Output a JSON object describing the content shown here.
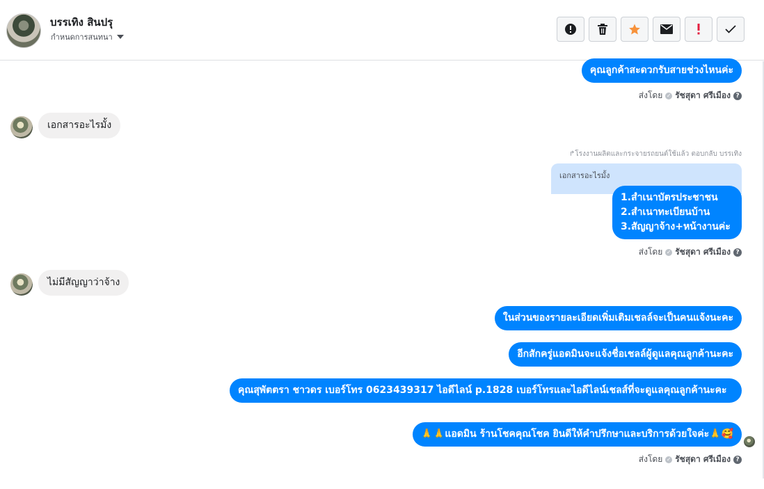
{
  "header": {
    "user_name": "บรรเทิง สินปรุ",
    "assign_label": "กำหนดการสนทนา"
  },
  "toolbar": {
    "items": [
      {
        "name": "report",
        "icon": "alert-circle-icon"
      },
      {
        "name": "delete",
        "icon": "trash-icon"
      },
      {
        "name": "star",
        "icon": "star-icon",
        "color": "#f7923b"
      },
      {
        "name": "mark-unread",
        "icon": "envelope-icon"
      },
      {
        "name": "important",
        "icon": "exclamation-icon",
        "color": "#e41e3f"
      },
      {
        "name": "done",
        "icon": "check-icon"
      }
    ]
  },
  "messages": {
    "m1": "คุณลูกค้าสะดวกรับสายช่วงไหนค่ะ",
    "m2": "เอกสารอะไรมั้ง",
    "reply_note": "↱โรงงานผลิตและกระจายรถยนต์ใช้แล้ว ตอบกลับ บรรเทิง",
    "quoted": "เอกสารอะไรมั้ง",
    "m3_line1": "1.สำเนาบัตรประชาชน",
    "m3_line2": "2.สำเนาทะเบียนบ้าน",
    "m3_line3": "3.สัญญาจ้าง+หน้างานค่ะ",
    "m4": "ไม่มีสัญญาว่าจ้าง",
    "m5": "ในส่วนของรายละเอียดเพิ่มเติมเชลล์จะเป็นคนแจ้งนะคะ",
    "m6": "อีกสักครู่แอดมินจะแจ้งชื่อเชลล์ผู้ดูแลคุณลูกค้านะคะ",
    "m7": "คุณสุพัตตรา   ชาวดร      เบอร์โทร 0623439317  ไอดีไลน์ p.1828   เบอร์โทรและไอดีไลน์เชลส์ที่จะดูแลคุณลูกค้านะคะ",
    "m8": "🙏🙏แอดมิน ร้านโชคคุณโชค ยินดีให้คำปรึกษาและบริการด้วยใจค่ะ🙏🥰"
  },
  "sent_by": {
    "prefix": "ส่งโดย",
    "agent": "รัชสุดา ศรีเมือง"
  }
}
